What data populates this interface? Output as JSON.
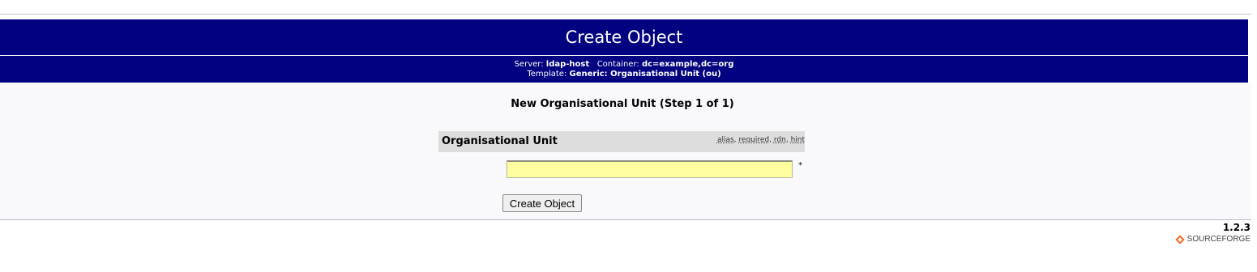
{
  "header": {
    "title": "Create Object",
    "server_label": "Server:",
    "server_value": "ldap-host",
    "container_label": "Container:",
    "container_value": "dc=example,dc=org",
    "template_label": "Template:",
    "template_value": "Generic: Organisational Unit (ou)"
  },
  "form": {
    "step_title": "New Organisational Unit (Step 1 of 1)",
    "attribute_label": "Organisational Unit",
    "hints": [
      "alias",
      "required",
      "rdn",
      "hint"
    ],
    "ou_value": "",
    "required_marker": "*",
    "submit_label": "Create Object"
  },
  "footer": {
    "version": "1.2.3",
    "logo_text": "SOURCEFORGE"
  },
  "colors": {
    "header_bg": "#000080",
    "input_bg": "#ffffa0",
    "logo_accent": "#f26722"
  }
}
